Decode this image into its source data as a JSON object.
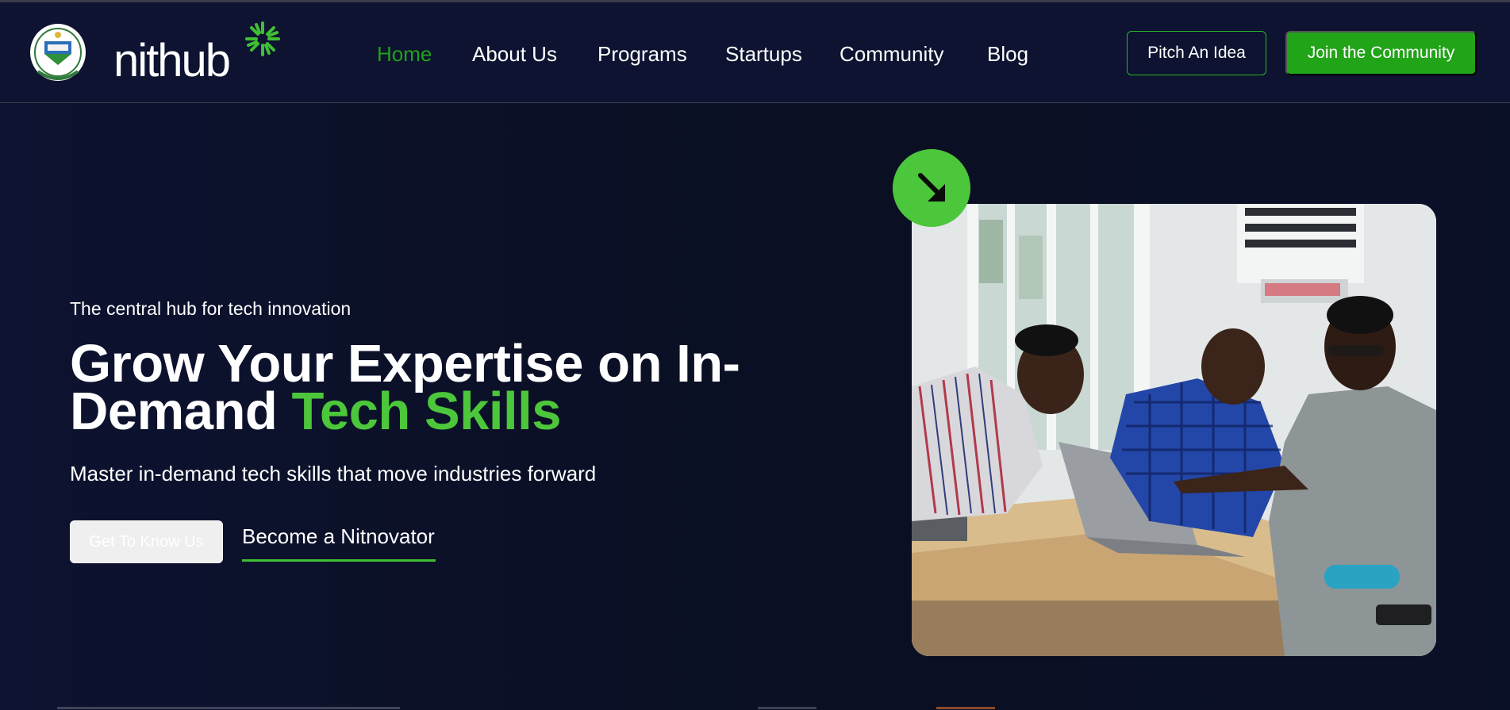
{
  "header": {
    "brand": "nithub",
    "nav": [
      {
        "label": "Home",
        "active": true
      },
      {
        "label": "About Us",
        "active": false
      },
      {
        "label": "Programs",
        "active": false
      },
      {
        "label": "Startups",
        "active": false
      },
      {
        "label": "Community",
        "active": false
      },
      {
        "label": "Blog",
        "active": false
      }
    ],
    "pitch_label": "Pitch An Idea",
    "join_label": "Join the Community"
  },
  "hero": {
    "tagline": "The central hub for tech innovation",
    "headline_main": "Grow Your Expertise on In-Demand ",
    "headline_accent": "Tech Skills",
    "subtext": "Master in-demand tech skills that move industries forward",
    "primary_button": "Get To Know Us",
    "secondary_link": "Become a Nitnovator"
  },
  "colors": {
    "background": "#0c1128",
    "accent_green": "#22a418",
    "highlight_green": "#4cc63a",
    "active_nav": "#23a01a"
  },
  "icons": {
    "seal": "university-seal-icon",
    "burst": "nithub-burst-icon",
    "arrow": "arrow-down-right-icon"
  }
}
